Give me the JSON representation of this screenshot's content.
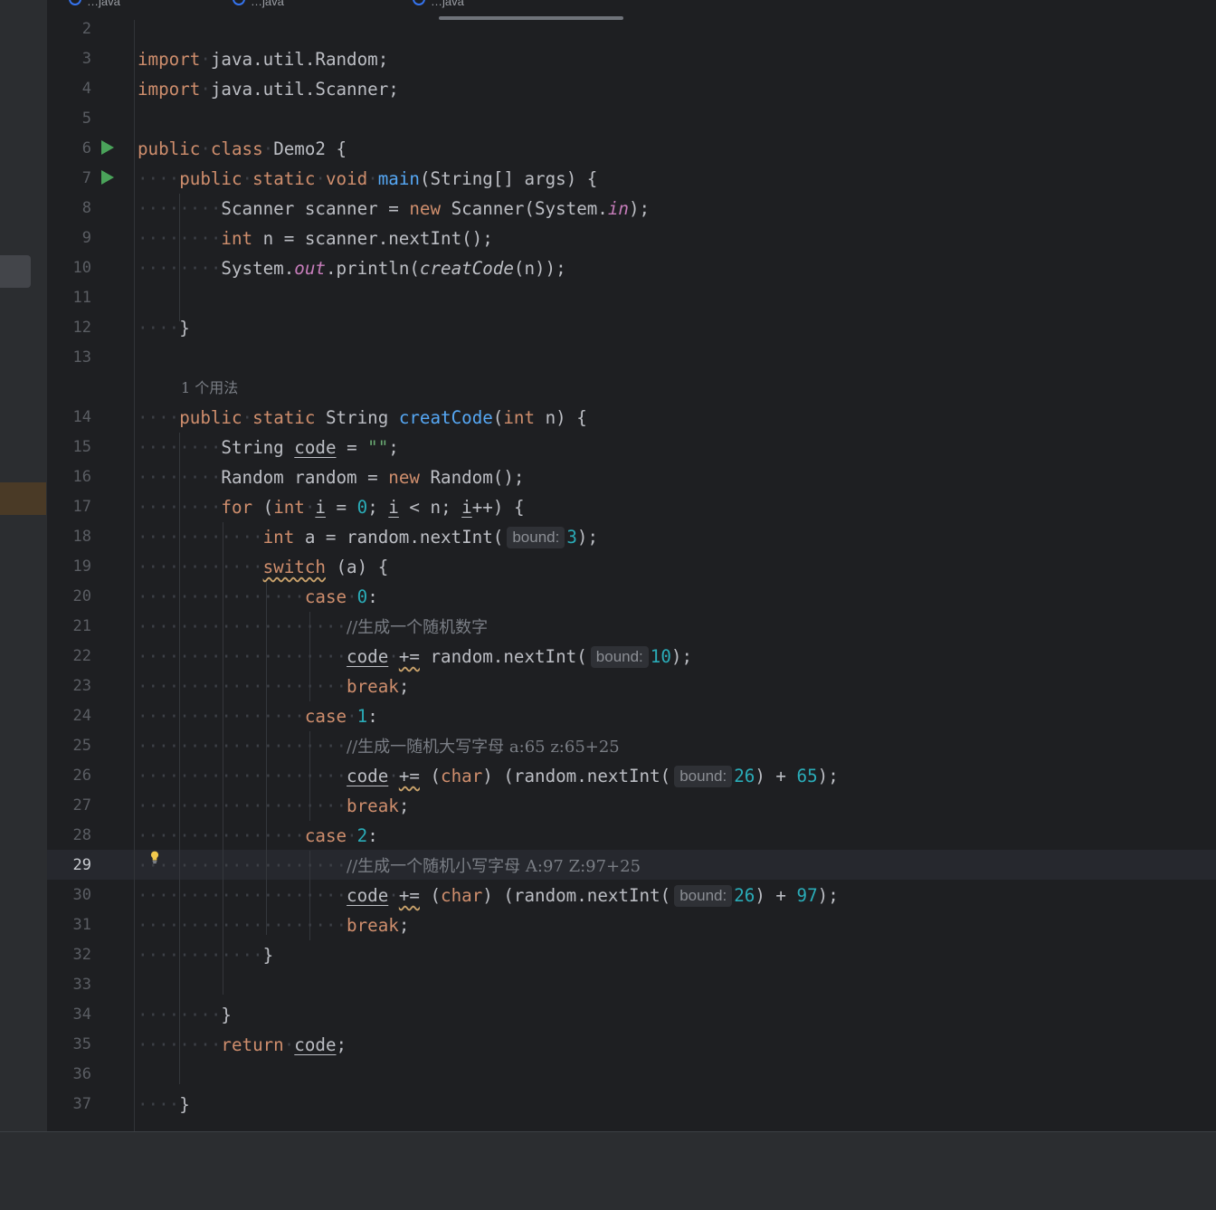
{
  "tabs": [
    {
      "label": "…java"
    },
    {
      "label": "…java"
    },
    {
      "label": "…java"
    }
  ],
  "gutter": {
    "line_numbers": [
      "2",
      "3",
      "4",
      "5",
      "6",
      "7",
      "8",
      "9",
      "10",
      "11",
      "12",
      "13",
      "14",
      "15",
      "16",
      "17",
      "18",
      "19",
      "20",
      "21",
      "22",
      "23",
      "24",
      "25",
      "26",
      "27",
      "28",
      "29",
      "30",
      "31",
      "32",
      "33",
      "34",
      "35",
      "36",
      "37"
    ],
    "current_line": "29"
  },
  "code": {
    "usages_hint": "1 个用法",
    "lines": {
      "l3": {
        "kw": "import",
        "rest": "java.util.Random;"
      },
      "l4": {
        "kw": "import",
        "rest": "java.util.Scanner;"
      },
      "l6": {
        "kw1": "public",
        "kw2": "class",
        "rest": "Demo2 {"
      },
      "l7": {
        "kw1": "public",
        "kw2": "static",
        "kw3": "void",
        "fn": "main",
        "rest": "(String[] args) {"
      },
      "l8": {
        "a": "Scanner scanner = ",
        "kw": "new",
        "b": " Scanner(System.",
        "stat": "in",
        "c": ");"
      },
      "l9": {
        "kw": "int",
        "rest": " n = scanner.nextInt();"
      },
      "l10": {
        "a": "System.",
        "stat": "out",
        "b": ".println(",
        "ital": "creatCode",
        "c": "(n));"
      },
      "l12": {
        "rest": "}"
      },
      "l14": {
        "kw1": "public",
        "kw2": "static",
        "a": " String ",
        "fn": "creatCode",
        "b": "(",
        "kw3": "int",
        "c": " n) {"
      },
      "l15": {
        "a": "String ",
        "var": "code",
        "b": " = ",
        "str": "\"\"",
        "c": ";"
      },
      "l16": {
        "a": "Random random = ",
        "kw": "new",
        "b": " Random();"
      },
      "l17": {
        "kw1": "for",
        "a": " (",
        "kw2": "int",
        "var1": "i",
        "b": " = ",
        "num": "0",
        "c": "; ",
        "var2": "i",
        "d": " < n; ",
        "var3": "i",
        "e": "++) {"
      },
      "l18": {
        "kw": "int",
        "a": " a = random.nextInt(",
        "hint": "bound:",
        "num": "3",
        "b": ");"
      },
      "l19": {
        "kw": "switch",
        "rest": " (a) {"
      },
      "l20": {
        "kw": "case",
        "num": "0",
        "rest": ":"
      },
      "l21": {
        "cmt": "//生成一个随机数字"
      },
      "l22": {
        "var": "code",
        "op": "+=",
        "a": " random.nextInt(",
        "hint": "bound:",
        "num": "10",
        "b": ");"
      },
      "l23": {
        "kw": "break",
        "rest": ";"
      },
      "l24": {
        "kw": "case",
        "num": "1",
        "rest": ":"
      },
      "l25": {
        "cmt": "//生成一随机大写字母 a:65 z:65+25"
      },
      "l26": {
        "var": "code",
        "op": "+=",
        "a": " (",
        "kw": "char",
        "b": ") (random.nextInt(",
        "hint": "bound:",
        "num1": "26",
        "c": ") + ",
        "num2": "65",
        "d": ");"
      },
      "l27": {
        "kw": "break",
        "rest": ";"
      },
      "l28": {
        "kw": "case",
        "num": "2",
        "rest": ":"
      },
      "l29": {
        "cmt": "//生成一个随机小写字母 A:97 Z:97+25"
      },
      "l30": {
        "var": "code",
        "op": "+=",
        "a": " (",
        "kw": "char",
        "b": ") (random.nextInt(",
        "hint": "bound:",
        "num1": "26",
        "c": ") + ",
        "num2": "97",
        "d": ");"
      },
      "l31": {
        "kw": "break",
        "rest": ";"
      },
      "l32": {
        "rest": "}"
      },
      "l34": {
        "rest": "}"
      },
      "l35": {
        "kw": "return",
        "var": "code",
        "rest": ";"
      },
      "l37": {
        "rest": "}"
      }
    }
  },
  "colors": {
    "background": "#1e1f22",
    "keyword": "#cf8e6d",
    "function": "#56a8f5",
    "number": "#2aacb8",
    "string": "#6aab73",
    "static_field": "#c77dbb",
    "comment": "#7a7e85",
    "run_icon": "#4aa35a",
    "bulb_icon": "#f2c94c"
  },
  "icons": {
    "run": "run-gutter-icon",
    "intention": "lightbulb-icon"
  }
}
